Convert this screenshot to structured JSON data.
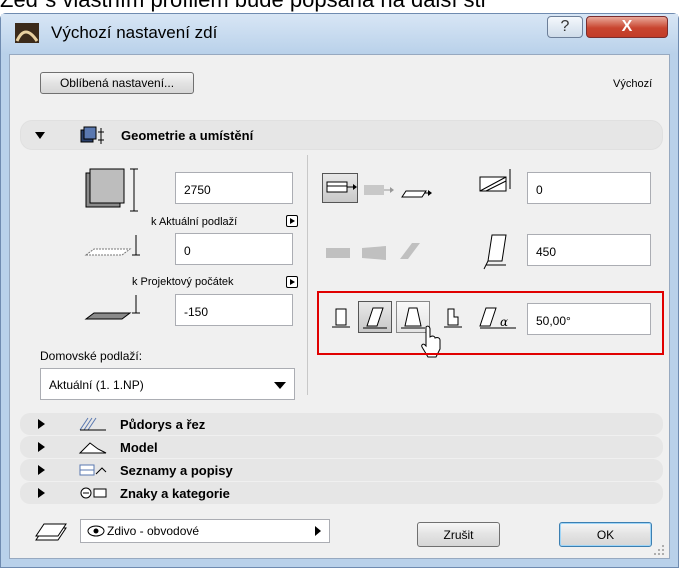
{
  "background_text": "Zeď s vlastním profilem bude popsána na další str",
  "window": {
    "title": "Výchozí nastavení zdí",
    "help_label": "?",
    "close_label": "X"
  },
  "header": {
    "favorites_button": "Oblíbená nastavení...",
    "default_label": "Výchozí"
  },
  "geometry": {
    "title": "Geometrie a umístění",
    "height_value": "2750",
    "top_link_label": "k Aktuální podlaží",
    "offset_value": "0",
    "base_link_label": "k Projektový počátek",
    "base_value": "-150",
    "home_story_label": "Domovské podlaží:",
    "home_story_value": "Aktuální (1. 1.NP)",
    "ref_offset_value": "0",
    "thickness_value": "450",
    "angle_value": "50,00°",
    "angle_symbol": "α"
  },
  "collapsed_sections": [
    {
      "label": "Půdorys a řez"
    },
    {
      "label": "Model"
    },
    {
      "label": "Seznamy a popisy"
    },
    {
      "label": "Znaky a kategorie"
    }
  ],
  "footer": {
    "layer_value": "Zdivo - obvodové",
    "cancel_label": "Zrušit",
    "ok_label": "OK"
  },
  "colors": {
    "highlight": "#e00000",
    "title_bar": "#b9d1ea",
    "close_button": "#c8452f"
  }
}
